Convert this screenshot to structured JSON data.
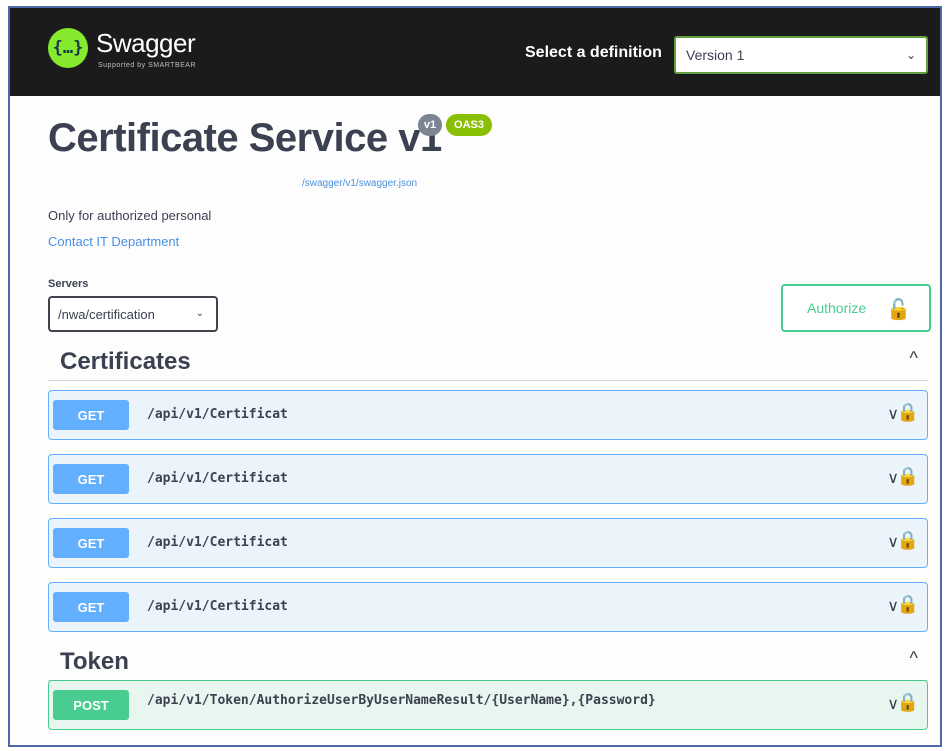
{
  "header": {
    "brand": "Swagger",
    "brand_sub": "Supported by SMARTBEAR",
    "select_label": "Select a definition",
    "definition_value": "Version 1"
  },
  "info": {
    "title": "Certificate Service v1",
    "version_badge": "v1",
    "oas_badge": "OAS3",
    "spec_link": "/swagger/v1/swagger.json",
    "description": "Only for authorized personal",
    "contact_link": "Contact IT Department"
  },
  "servers": {
    "label": "Servers",
    "selected": "/nwa/certification"
  },
  "authorize_label": "Authorize",
  "sections": [
    {
      "name": "Certificates",
      "operations": [
        {
          "method": "GET",
          "path": "/api/v1/Certificat"
        },
        {
          "method": "GET",
          "path": "/api/v1/Certificat"
        },
        {
          "method": "GET",
          "path": "/api/v1/Certificat"
        },
        {
          "method": "GET",
          "path": "/api/v1/Certificat"
        }
      ]
    },
    {
      "name": "Token",
      "operations": [
        {
          "method": "POST",
          "path": "/api/v1/Token/AuthorizeUserByUserNameResult/{UserName},{Password}"
        }
      ]
    }
  ],
  "colors": {
    "get": "#61affe",
    "post": "#49cc90",
    "topbar": "#1b1b1b",
    "accent_green": "#85ea2d"
  },
  "icons": {
    "logo": "swagger-logo-icon",
    "chevron": "chevron-down-icon",
    "lock": "lock-icon"
  }
}
